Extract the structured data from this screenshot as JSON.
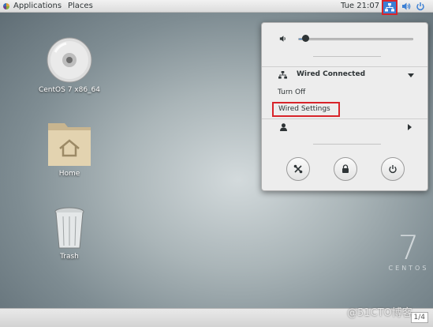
{
  "topbar": {
    "applications_label": "Applications",
    "places_label": "Places",
    "clock": "Tue 21:07",
    "tray_icons": [
      "network-wired-icon",
      "volume-icon",
      "power-icon"
    ]
  },
  "desktop": {
    "icons": [
      {
        "label": "CentOS 7 x86_64",
        "icon": "optical-disc-icon"
      },
      {
        "label": "Home",
        "icon": "home-folder-icon"
      },
      {
        "label": "Trash",
        "icon": "trash-icon"
      }
    ],
    "brand_number": "7",
    "brand_word": "CENTOS"
  },
  "system_menu": {
    "volume_level": 0.05,
    "network_title": "Wired Connected",
    "turn_off_label": "Turn Off",
    "wired_settings_label": "Wired Settings",
    "bottom_buttons": [
      "settings-icon",
      "lock-icon",
      "power-icon"
    ]
  },
  "watermark": "@51CTO博客",
  "pager": "1/4",
  "colors": {
    "highlight_border": "#d8242a",
    "accent_blue": "#3b7fd4"
  }
}
